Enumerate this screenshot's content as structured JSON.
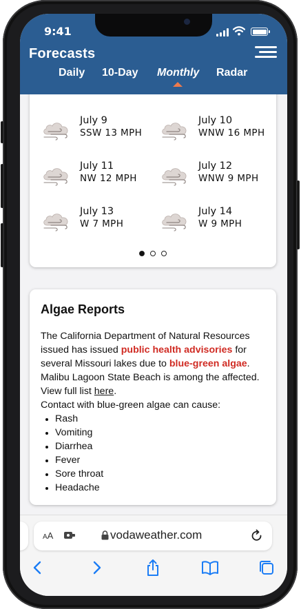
{
  "status_bar": {
    "time": "9:41"
  },
  "app": {
    "title": "Forecasts",
    "tabs": [
      {
        "label": "Daily",
        "active": false
      },
      {
        "label": "10-Day",
        "active": false
      },
      {
        "label": "Monthly",
        "active": true
      },
      {
        "label": "Radar",
        "active": false
      }
    ],
    "accent_color": "#2b5d92",
    "caret_color": "#ee7a4c"
  },
  "wind_forecast": {
    "days": [
      {
        "date": "July 9",
        "wind": "SSW 13 MPH",
        "icon": "windy-cloud-icon"
      },
      {
        "date": "July 10",
        "wind": "WNW 16 MPH",
        "icon": "windy-cloud-icon"
      },
      {
        "date": "July 11",
        "wind": "NW 12 MPH",
        "icon": "windy-cloud-icon"
      },
      {
        "date": "July 12",
        "wind": "WNW 9 MPH",
        "icon": "windy-cloud-icon"
      },
      {
        "date": "July 13",
        "wind": "W 7 MPH",
        "icon": "windy-cloud-icon"
      },
      {
        "date": "July 14",
        "wind": "W 9 MPH",
        "icon": "windy-cloud-icon"
      }
    ],
    "pagination": {
      "total": 3,
      "current": 1
    }
  },
  "algae_reports": {
    "title": "Algae Reports",
    "text_1": "The California Department of Natural Resources issued has issued ",
    "highlight_1": "public health advisories",
    "text_2": " for several Missouri lakes due to ",
    "highlight_2": "blue-green algae",
    "text_3": ". Malibu Lagoon State Beach is among the affected. View full list ",
    "link": "here",
    "text_4": ".",
    "text_5": "Contact with blue-green algae can cause:",
    "symptoms": [
      "Rash",
      "Vomiting",
      "Diarrhea",
      "Fever",
      "Sore throat",
      "Headache"
    ],
    "highlight_color": "#d02b23"
  },
  "browser": {
    "text_size_small": "A",
    "text_size_large": "A",
    "url": "vodaweather.com"
  }
}
